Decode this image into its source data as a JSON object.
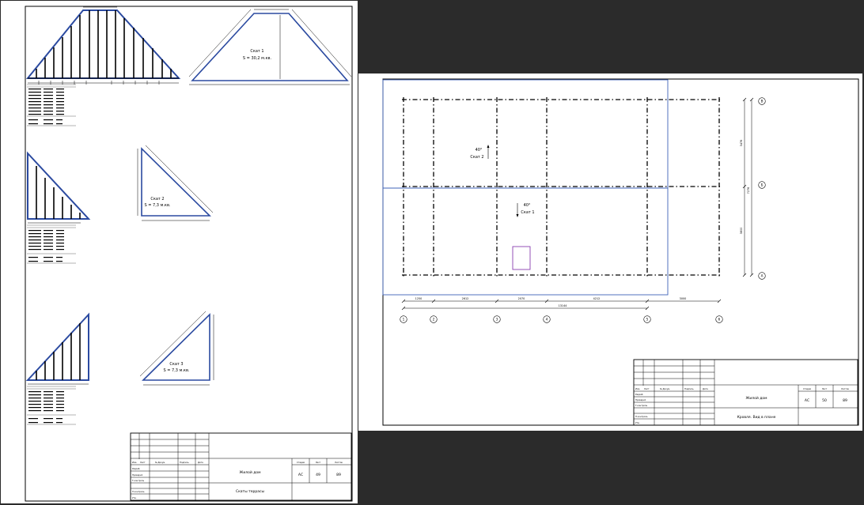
{
  "sheet1": {
    "slopes": [
      {
        "label": "Скат 1",
        "area": "S = 30,2 м.кв."
      },
      {
        "label": "Скат 2",
        "area": "S = 7,3 м.кв."
      },
      {
        "label": "Скат 3",
        "area": "S = 7,3 м.кв."
      }
    ],
    "title_block": {
      "col_izm": "Изм.",
      "col_list": "Лист",
      "col_doc": "№ Докум.",
      "col_sign": "Подпись",
      "col_date": "Дата",
      "razrab": "Разраб.",
      "proveril": "Проверил",
      "t_kontrol": "Т.контроль",
      "n_kontrol": "Н.контроль",
      "utv": "Утв.",
      "project": "Жилой дом",
      "stage_label": "Стадия",
      "sheet_label": "Лист",
      "sheets_label": "Листов",
      "stage": "АС",
      "sheet_no": "49",
      "sheets_total": "89",
      "drawing_title": "Скаты террасы"
    }
  },
  "sheet2": {
    "slope_labels": [
      {
        "angle": "40°",
        "name": "Скат 2"
      },
      {
        "angle": "40°",
        "name": "Скат 1"
      }
    ],
    "dims_bottom": [
      "1250",
      "2612",
      "2070",
      "4212",
      "3000"
    ],
    "dim_total": "13144",
    "dims_right": [
      "3476",
      "7276",
      "3800"
    ],
    "axes_numbers": [
      "1",
      "2",
      "3",
      "4",
      "5",
      "6"
    ],
    "axes_letters": [
      "В",
      "Б",
      "А"
    ],
    "title_block": {
      "col_izm": "Изм.",
      "col_list": "Лист",
      "col_doc": "№ Докум.",
      "col_sign": "Подпись",
      "col_date": "Дата",
      "razrab": "Разраб.",
      "proveril": "Проверил",
      "t_kontrol": "Т.контроль",
      "n_kontrol": "Н.контроль",
      "utv": "Утв.",
      "project": "Жилой дом",
      "stage_label": "Стадия",
      "sheet_label": "Лист",
      "sheets_label": "Листов",
      "stage": "АС",
      "sheet_no": "50",
      "sheets_total": "89",
      "drawing_title": "Кровля. Вид в плане"
    }
  }
}
